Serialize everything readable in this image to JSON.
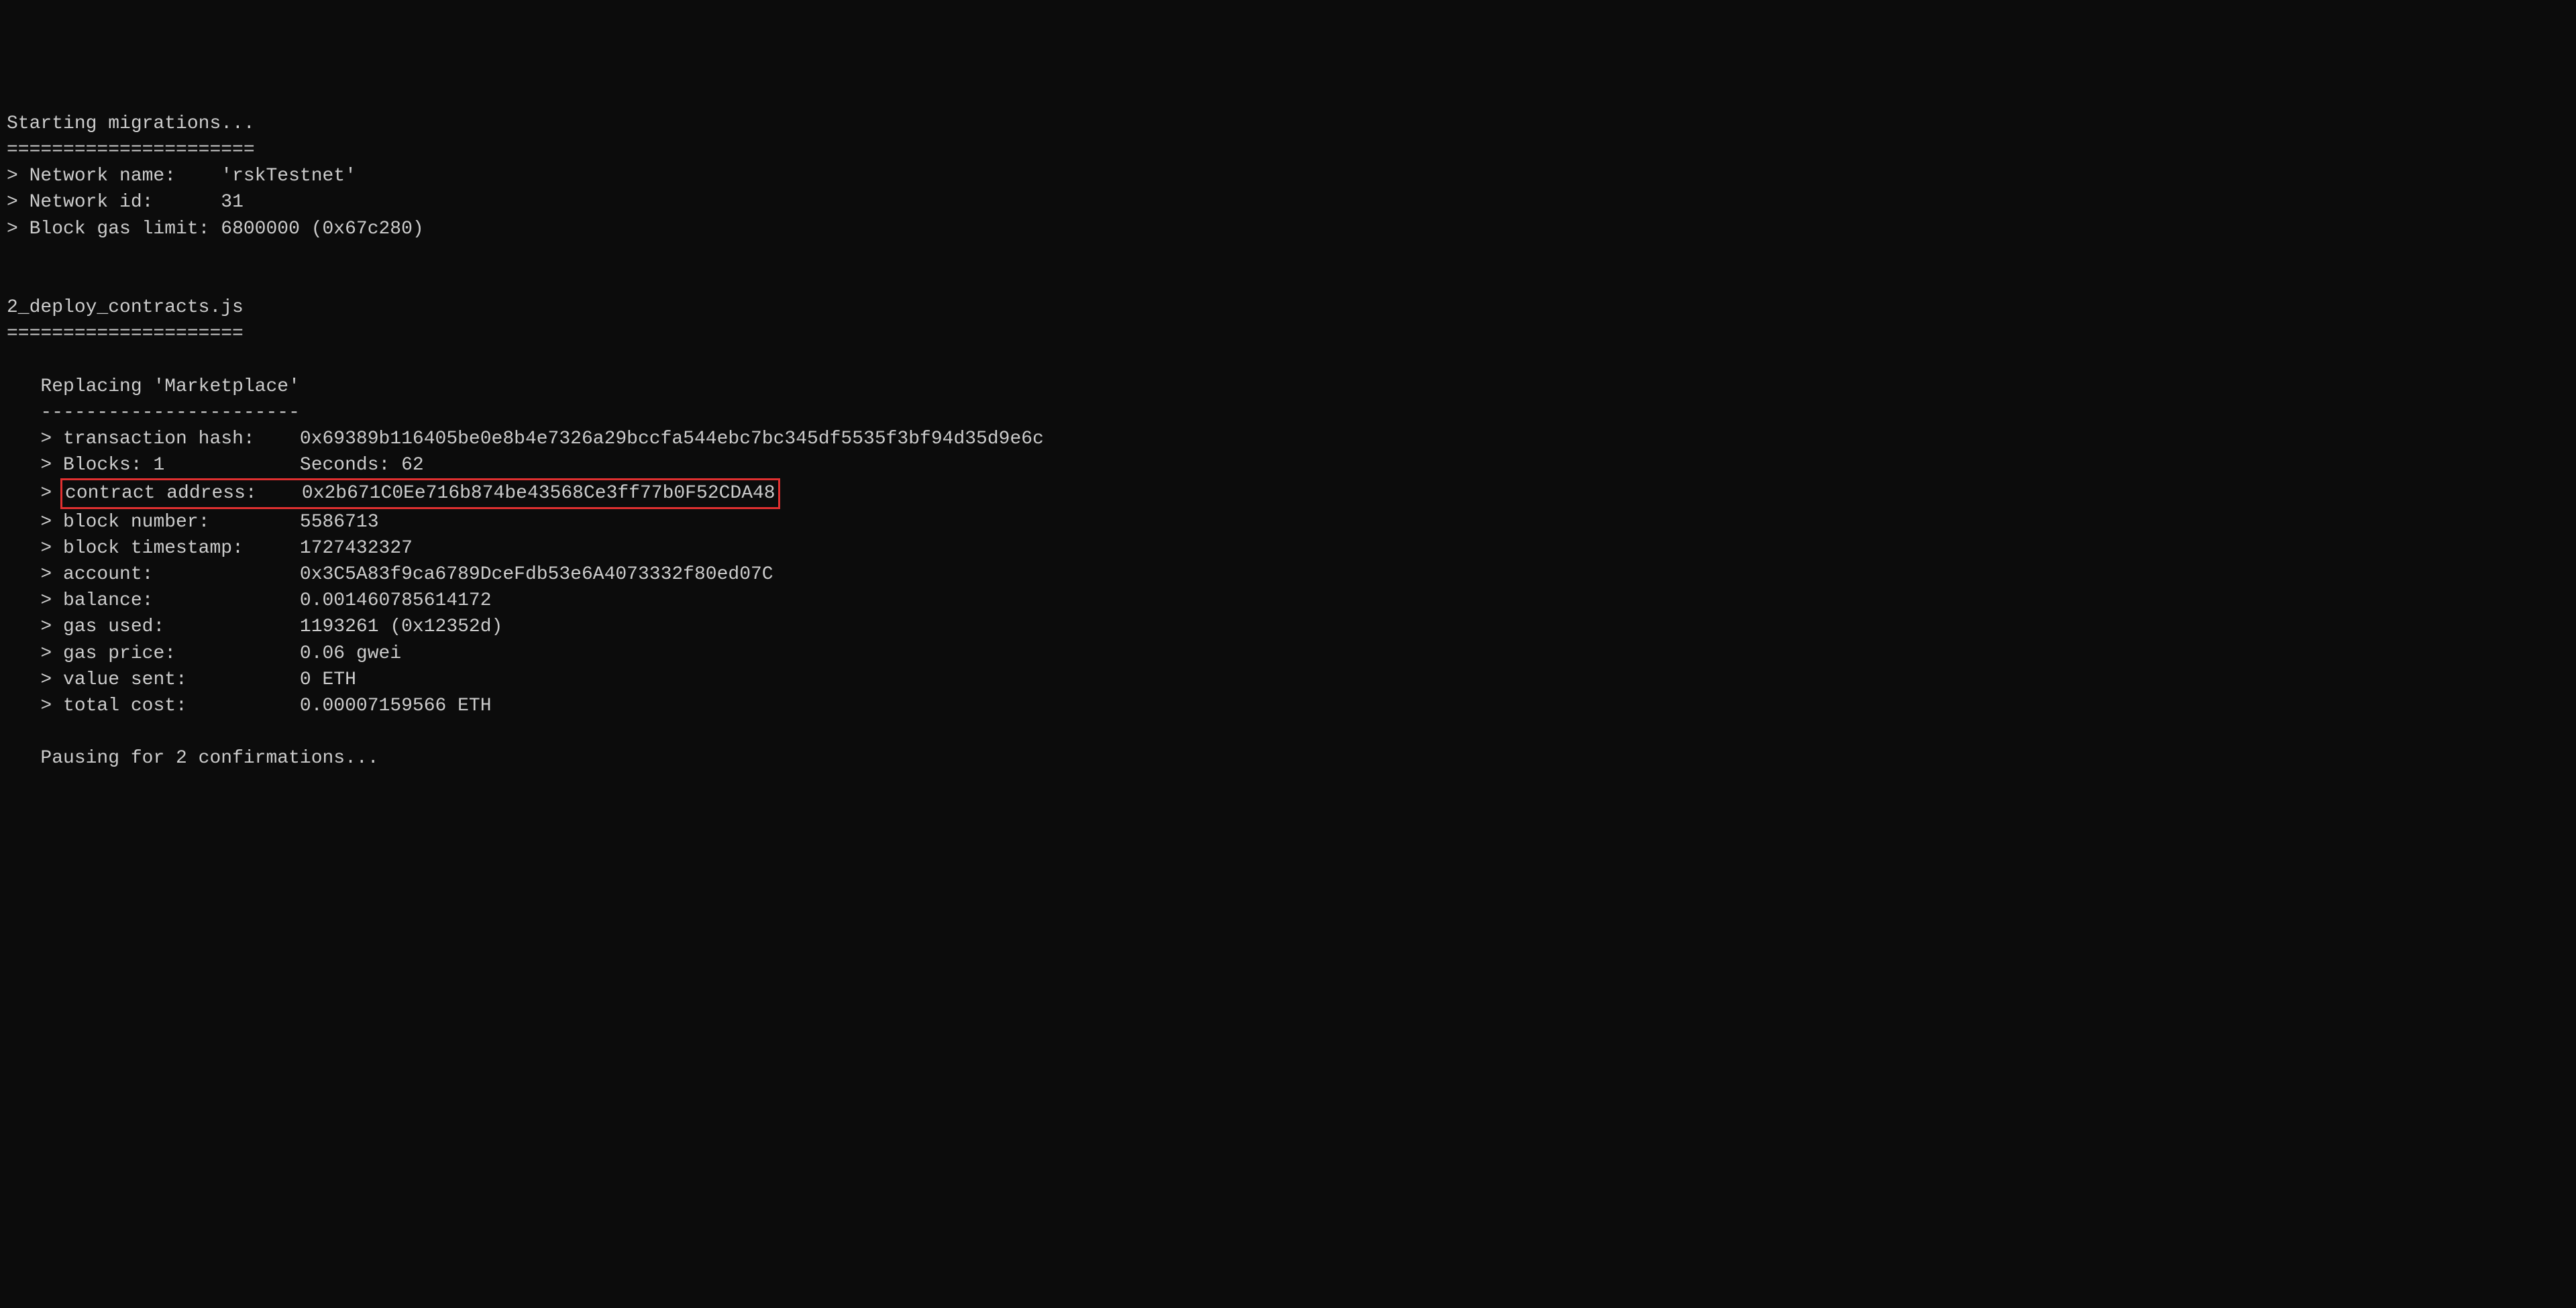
{
  "header": {
    "starting": "Starting migrations...",
    "separator": "======================",
    "network_name_label": "> Network name:    ",
    "network_name_value": "'rskTestnet'",
    "network_id_label": "> Network id:      ",
    "network_id_value": "31",
    "block_gas_label": "> Block gas limit: ",
    "block_gas_value": "6800000 (0x67c280)"
  },
  "migration": {
    "filename": "2_deploy_contracts.js",
    "separator": "====================="
  },
  "deploy": {
    "indent": "   ",
    "replacing": "Replacing 'Marketplace'",
    "dashes": "-----------------------",
    "tx_hash_label": "> transaction hash:    ",
    "tx_hash_value": "0x69389b116405be0e8b4e7326a29bccfa544ebc7bc345df5535f3bf94d35d9e6c",
    "blocks_label": "> Blocks: 1            ",
    "blocks_value": "Seconds: 62",
    "contract_addr_label": "contract address:    ",
    "contract_addr_value": "0x2b671C0Ee716b874be43568Ce3ff77b0F52CDA48",
    "block_number_label": "> block number:        ",
    "block_number_value": "5586713",
    "block_timestamp_label": "> block timestamp:     ",
    "block_timestamp_value": "1727432327",
    "account_label": "> account:             ",
    "account_value": "0x3C5A83f9ca6789DceFdb53e6A4073332f80ed07C",
    "balance_label": "> balance:             ",
    "balance_value": "0.001460785614172",
    "gas_used_label": "> gas used:            ",
    "gas_used_value": "1193261 (0x12352d)",
    "gas_price_label": "> gas price:           ",
    "gas_price_value": "0.06 gwei",
    "value_sent_label": "> value sent:          ",
    "value_sent_value": "0 ETH",
    "total_cost_label": "> total cost:          ",
    "total_cost_value": "0.00007159566 ETH",
    "pausing": "Pausing for 2 confirmations..."
  },
  "gt": "> "
}
